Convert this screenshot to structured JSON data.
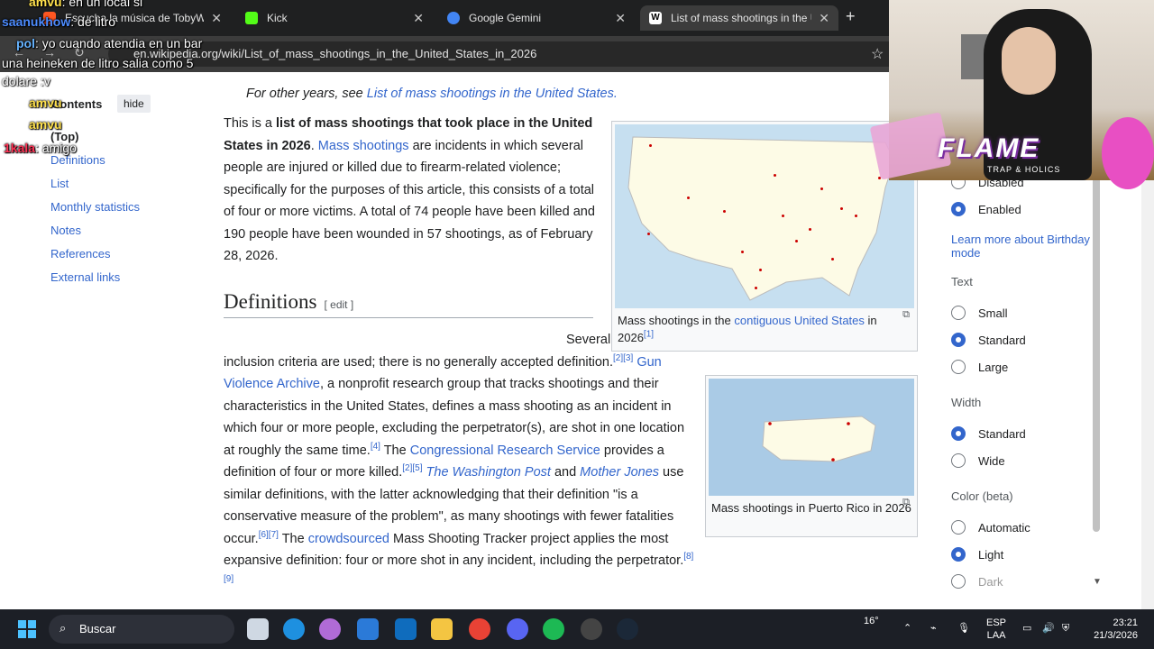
{
  "browser": {
    "tabs": [
      {
        "label": "Escucha la música de TobyWue",
        "color": "#ff5722"
      },
      {
        "label": "Kick",
        "color": "#53fc18"
      },
      {
        "label": "Google Gemini",
        "color": "#4285f4"
      },
      {
        "label": "List of mass shootings in the U",
        "color": "#ffffff"
      }
    ],
    "url": "en.wikipedia.org/wiki/List_of_mass_shootings_in_the_United_States_in_2026"
  },
  "chat": [
    {
      "user": "amvu",
      "text": ": en un local si"
    },
    {
      "user": "saanukhow",
      "text": ": de litro"
    },
    {
      "user": "pol",
      "text": ": yo cuando atendia en un bar"
    },
    {
      "user": "",
      "text": "una heineken de litro salia como 5"
    },
    {
      "user": "",
      "text": "dolare :v"
    },
    {
      "user": "amvu",
      "text": ""
    },
    {
      "user": "amvu",
      "text": ""
    },
    {
      "user": "1kala",
      "text": ": amigo"
    }
  ],
  "toc": {
    "title": "Contents",
    "hide": "hide",
    "top": "(Top)",
    "items": [
      "Definitions",
      "List",
      "Monthly statistics",
      "Notes",
      "References",
      "External links"
    ]
  },
  "article": {
    "hatnote_prefix": "For other years, see ",
    "hatnote_link": "List of mass shootings in the United States.",
    "p1_intro": "This is a ",
    "p1_bold": "list of mass shootings that took place in the United States in 2026",
    "p1_dot": ". ",
    "p1_link": "Mass shootings",
    "p1_rest": " are incidents in which several people are injured or killed due to firearm-related violence; specifically for the purposes of this article, this consists of a total of four or more victims. A total of 74 people have been killed and 190 people have been wounded in 57 shootings, as of February 28, 2026.",
    "h2": "Definitions",
    "edit": "[ edit ]",
    "p2_a": "Several different inclusion criteria are used; there is no generally accepted definition.",
    "ref23": "[2][3]",
    "gva": "Gun Violence Archive",
    "p2_b": ", a nonprofit research group that tracks shootings and their characteristics in the United States, defines a mass shooting as an incident in which four or more people, excluding the perpetrator(s), are shot in one location at roughly the same time.",
    "ref4": "[4]",
    "p2_c": " The ",
    "crs": "Congressional Research Service",
    "p2_d": " provides a definition of four or more killed.",
    "ref25": "[2][5]",
    "wapo": "The Washington Post",
    "p2_e": " and ",
    "mj": "Mother Jones",
    "p2_f": " use similar definitions, with the latter acknowledging that their definition \"is a conservative measure of the problem\", as many shootings with fewer fatalities occur.",
    "ref67": "[6][7]",
    "p2_g": " The ",
    "crowd": "crowdsourced",
    "p2_h": " Mass Shooting Tracker project applies the most expansive definition: four or more shot in any incident, including the perpetrator.",
    "ref89": "[8][9]"
  },
  "figures": {
    "us_caption_a": "Mass shootings in the ",
    "us_caption_link": "contiguous United States",
    "us_caption_b": " in 2026",
    "us_ref": "[1]",
    "pr_caption": "Mass shootings in Puerto Rico in 2026"
  },
  "panel": {
    "disabled": "Disabled",
    "enabled": "Enabled",
    "learn_more": "Learn more about Birthday mode",
    "text_heading": "Text",
    "text_options": [
      "Small",
      "Standard",
      "Large"
    ],
    "width_heading": "Width",
    "width_options": [
      "Standard",
      "Wide"
    ],
    "color_heading": "Color (beta)",
    "color_options": [
      "Automatic",
      "Light",
      "Dark"
    ]
  },
  "overlay": {
    "flame": "FLAME",
    "flame_sub": "TRAP & HOLICS"
  },
  "taskbar": {
    "search": "Buscar",
    "temp": "16°",
    "lang1": "ESP",
    "lang2": "LAA",
    "time": "23:21",
    "date": "21/3/2026"
  }
}
